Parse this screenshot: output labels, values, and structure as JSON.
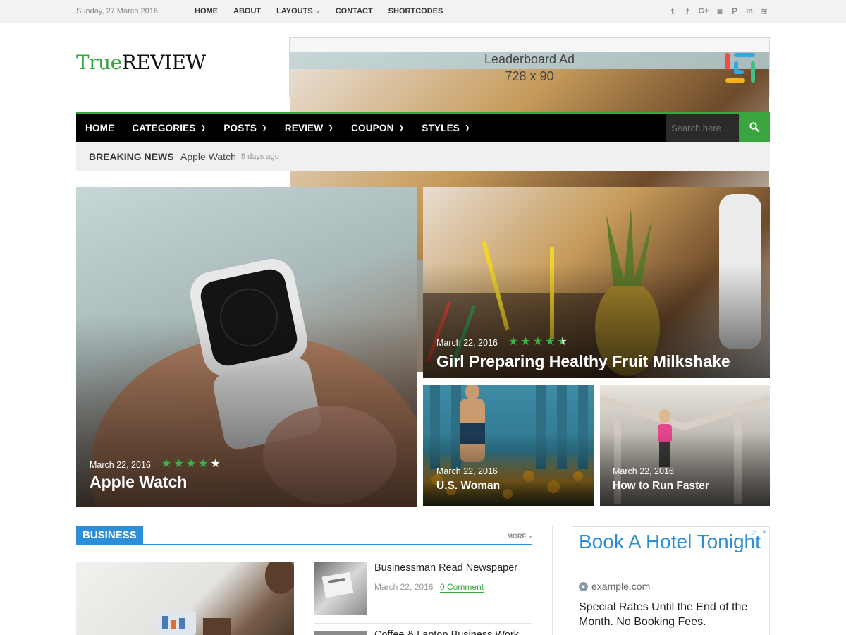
{
  "topbar": {
    "date": "Sunday, 27 March 2016",
    "nav": [
      {
        "label": "HOME",
        "dropdown": false
      },
      {
        "label": "ABOUT",
        "dropdown": false
      },
      {
        "label": "LAYOUTS",
        "dropdown": true
      },
      {
        "label": "CONTACT",
        "dropdown": false
      },
      {
        "label": "SHORTCODES",
        "dropdown": false
      }
    ],
    "social_icons": [
      {
        "name": "twitter-icon",
        "glyph": "t"
      },
      {
        "name": "facebook-icon",
        "glyph": "f"
      },
      {
        "name": "google-plus-icon",
        "glyph": "G+"
      },
      {
        "name": "instagram-icon",
        "glyph": "◙"
      },
      {
        "name": "pinterest-icon",
        "glyph": "P"
      },
      {
        "name": "linkedin-icon",
        "glyph": "in"
      },
      {
        "name": "rss-icon",
        "glyph": "≋"
      }
    ]
  },
  "header": {
    "logo_part1": "True",
    "logo_part2": "REVIEW",
    "ad_line1": "Leaderboard Ad",
    "ad_line2": "728 x 90"
  },
  "mainnav": {
    "items": [
      {
        "label": "HOME",
        "dropdown": false
      },
      {
        "label": "CATEGORIES",
        "dropdown": true
      },
      {
        "label": "POSTS",
        "dropdown": true
      },
      {
        "label": "REVIEW",
        "dropdown": true
      },
      {
        "label": "COUPON",
        "dropdown": true
      },
      {
        "label": "STYLES",
        "dropdown": true
      }
    ],
    "search_placeholder": "Search here ..."
  },
  "breaking": {
    "label": "BREAKING NEWS",
    "title": "Apple Watch",
    "ago": "5 days ago"
  },
  "featured": [
    {
      "date": "March 22, 2016",
      "title": "Apple Watch",
      "rating_stars": 4
    },
    {
      "date": "March 22, 2016",
      "title": "Girl Preparing Healthy Fruit Milkshake",
      "rating_stars": 4.5
    },
    {
      "date": "March 22, 2016",
      "title": "U.S. Woman"
    },
    {
      "date": "March 22, 2016",
      "title": "How to Run Faster"
    }
  ],
  "business": {
    "label": "BUSINESS",
    "more": "MORE »",
    "post1_title": "Businessman Read Newspaper",
    "post1_date": "March 22, 2016",
    "post1_comment": "0 Comment",
    "post2_title": "Coffee & Laptop Business Work"
  },
  "side_ad": {
    "headline": "Book A Hotel Tonight",
    "url": "example.com",
    "description": "Special Rates Until the End of the Month. No Booking Fees."
  },
  "colors": {
    "accent_green": "#3aa53f",
    "accent_blue": "#2d8ed8",
    "star_green": "#3bb54a"
  }
}
